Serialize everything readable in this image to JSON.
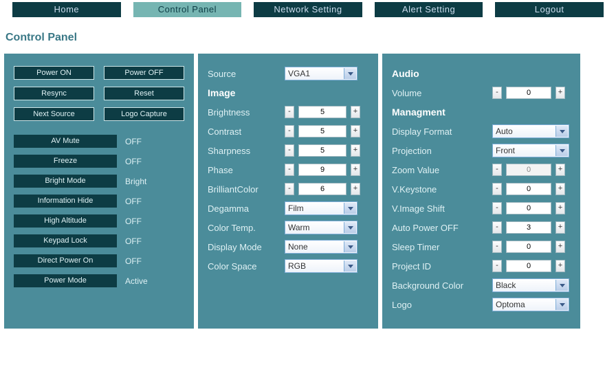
{
  "nav": {
    "home": "Home",
    "control": "Control Panel",
    "network": "Network Setting",
    "alert": "Alert Setting",
    "logout": "Logout"
  },
  "page_title": "Control Panel",
  "panel1": {
    "power_on": "Power ON",
    "power_off": "Power OFF",
    "resync": "Resync",
    "reset": "Reset",
    "next_source": "Next Source",
    "logo_capture": "Logo Capture",
    "toggles": [
      {
        "label": "AV Mute",
        "value": "OFF"
      },
      {
        "label": "Freeze",
        "value": "OFF"
      },
      {
        "label": "Bright Mode",
        "value": "Bright"
      },
      {
        "label": "Information Hide",
        "value": "OFF"
      },
      {
        "label": "High Altitude",
        "value": "OFF"
      },
      {
        "label": "Keypad Lock",
        "value": "OFF"
      },
      {
        "label": "Direct Power On",
        "value": "OFF"
      },
      {
        "label": "Power Mode",
        "value": "Active"
      }
    ]
  },
  "panel2": {
    "source_lbl": "Source",
    "source_val": "VGA1",
    "image_hdr": "Image",
    "brightness_lbl": "Brightness",
    "brightness_val": "5",
    "contrast_lbl": "Contrast",
    "contrast_val": "5",
    "sharpness_lbl": "Sharpness",
    "sharpness_val": "5",
    "phase_lbl": "Phase",
    "phase_val": "9",
    "brilliant_lbl": "BrilliantColor",
    "brilliant_val": "6",
    "degamma_lbl": "Degamma",
    "degamma_val": "Film",
    "colortemp_lbl": "Color Temp.",
    "colortemp_val": "Warm",
    "dispmode_lbl": "Display Mode",
    "dispmode_val": "None",
    "colorspace_lbl": "Color Space",
    "colorspace_val": "RGB",
    "minus": "-",
    "plus": "+"
  },
  "panel3": {
    "audio_hdr": "Audio",
    "volume_lbl": "Volume",
    "volume_val": "0",
    "mgmt_hdr": "Managment",
    "dispfmt_lbl": "Display Format",
    "dispfmt_val": "Auto",
    "proj_lbl": "Projection",
    "proj_val": "Front",
    "zoom_lbl": "Zoom Value",
    "zoom_val": "0",
    "vkey_lbl": "V.Keystone",
    "vkey_val": "0",
    "vimg_lbl": "V.Image Shift",
    "vimg_val": "0",
    "autopoff_lbl": "Auto Power OFF",
    "autopoff_val": "3",
    "sleep_lbl": "Sleep Timer",
    "sleep_val": "0",
    "projid_lbl": "Project ID",
    "projid_val": "0",
    "bgcolor_lbl": "Background Color",
    "bgcolor_val": "Black",
    "logo_lbl": "Logo",
    "logo_val": "Optoma",
    "minus": "-",
    "plus": "+"
  }
}
